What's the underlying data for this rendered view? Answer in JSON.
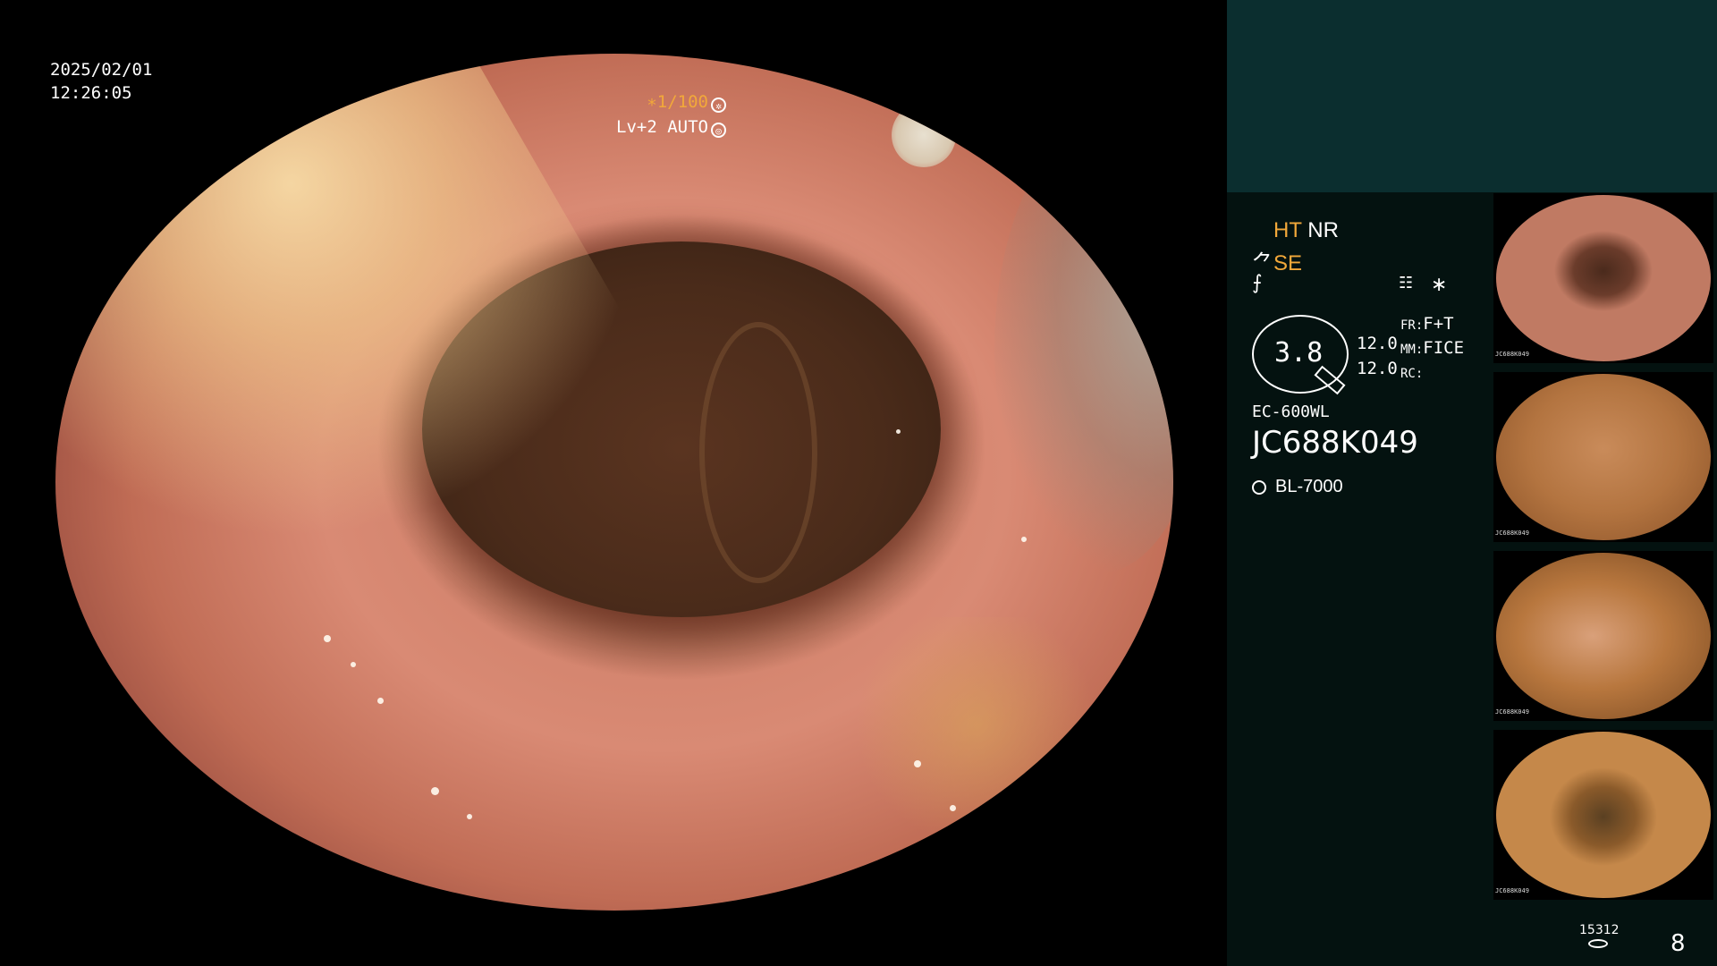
{
  "overlay": {
    "date": "2025/02/01",
    "time": "12:26:05",
    "shutter": "∗1/100",
    "level_mode": "Lv+2 AUTO"
  },
  "panel": {
    "mode_ht": "HT",
    "mode_nr": "NR",
    "mode_se": "SE",
    "magnification": "3.8",
    "dist_values": [
      "12.0",
      "12.0"
    ],
    "fr_label": "FR:",
    "fr_value": "F+T",
    "mm_label": "MM:",
    "mm_value": "FICE",
    "rc_label": "RC:",
    "rc_value": "",
    "asterisk": "∗",
    "scope_model": "EC-600WL",
    "scope_serial": "JC688K049",
    "light_source": "BL-7000",
    "storage_count": "15312",
    "page_number": "8"
  },
  "thumbnails": [
    {
      "label": "JC688K049"
    },
    {
      "label": "JC688K049"
    },
    {
      "label": "JC688K049"
    },
    {
      "label": "JC688K049"
    }
  ],
  "colors": {
    "accent_orange": "#f2a83a",
    "panel_top": "#0b2e2f",
    "panel_bg": "#041210"
  }
}
